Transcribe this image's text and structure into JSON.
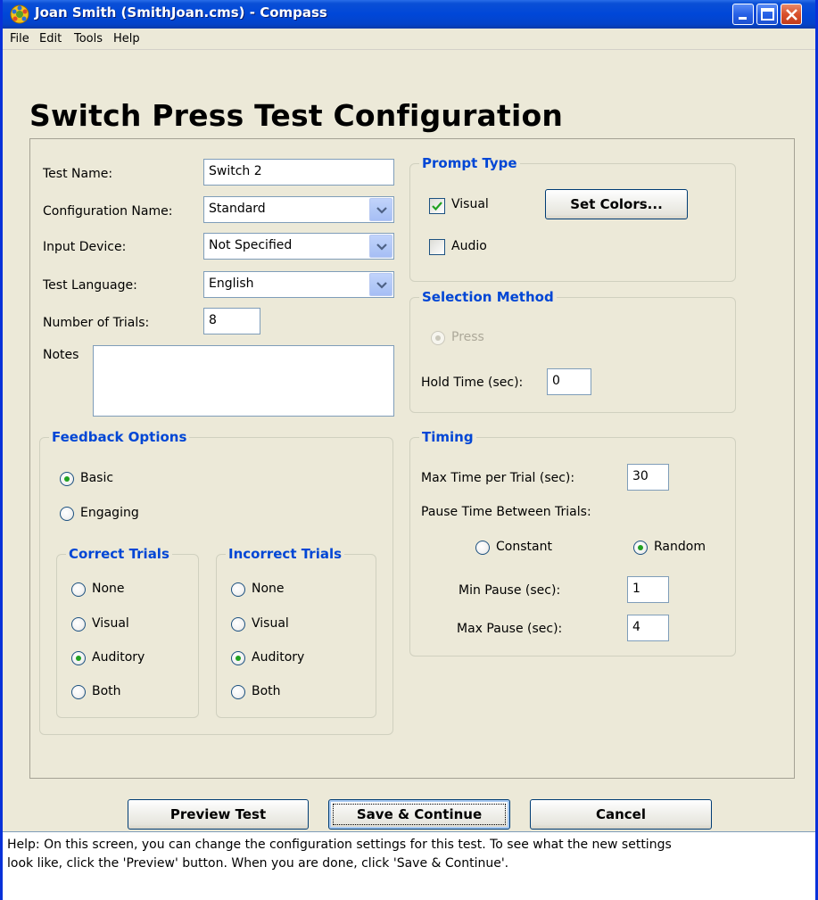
{
  "window": {
    "title": "Joan Smith (SmithJoan.cms) - Compass"
  },
  "menu": {
    "items": [
      {
        "label": "File"
      },
      {
        "label": "Edit"
      },
      {
        "label": "Tools"
      },
      {
        "label": "Help"
      }
    ]
  },
  "page": {
    "title": "Switch Press Test Configuration"
  },
  "form": {
    "test_name_label": "Test Name:",
    "test_name_value": "Switch 2",
    "config_name_label": "Configuration Name:",
    "config_name_value": "Standard",
    "input_device_label": "Input Device:",
    "input_device_value": "Not Specified",
    "test_language_label": "Test Language:",
    "test_language_value": "English",
    "num_trials_label": "Number of Trials:",
    "num_trials_value": "8",
    "notes_label": "Notes",
    "notes_value": ""
  },
  "feedback": {
    "title": "Feedback Options",
    "basic_label": "Basic",
    "basic_selected": true,
    "engaging_label": "Engaging",
    "engaging_selected": false,
    "correct": {
      "title": "Correct Trials",
      "none": "None",
      "visual": "Visual",
      "auditory": "Auditory",
      "both": "Both",
      "selected": "Auditory"
    },
    "incorrect": {
      "title": "Incorrect Trials",
      "none": "None",
      "visual": "Visual",
      "auditory": "Auditory",
      "both": "Both",
      "selected": "Auditory"
    }
  },
  "prompt": {
    "title": "Prompt Type",
    "visual_label": "Visual",
    "visual_checked": true,
    "audio_label": "Audio",
    "audio_checked": false,
    "set_colors_label": "Set Colors..."
  },
  "selection": {
    "title": "Selection Method",
    "press_label": "Press",
    "press_selected": true,
    "hold_time_label": "Hold Time (sec):",
    "hold_time_value": "0"
  },
  "timing": {
    "title": "Timing",
    "max_time_label": "Max Time per Trial (sec):",
    "max_time_value": "30",
    "pause_label": "Pause Time Between Trials:",
    "constant_label": "Constant",
    "constant_selected": false,
    "random_label": "Random",
    "random_selected": true,
    "min_pause_label": "Min Pause (sec):",
    "min_pause_value": "1",
    "max_pause_label": "Max Pause (sec):",
    "max_pause_value": "4"
  },
  "buttons": {
    "preview": "Preview Test",
    "save": "Save & Continue",
    "cancel": "Cancel"
  },
  "help": {
    "line1": "Help: On this screen, you can change the configuration settings for this test.  To see what the new settings",
    "line2": "look like, click the 'Preview' button.  When you are done, click 'Save & Continue'."
  },
  "colors": {
    "titlebar": "#0047d8",
    "group_title": "#0046d5",
    "background": "#ece9d8",
    "radio_dot": "#21a121"
  }
}
